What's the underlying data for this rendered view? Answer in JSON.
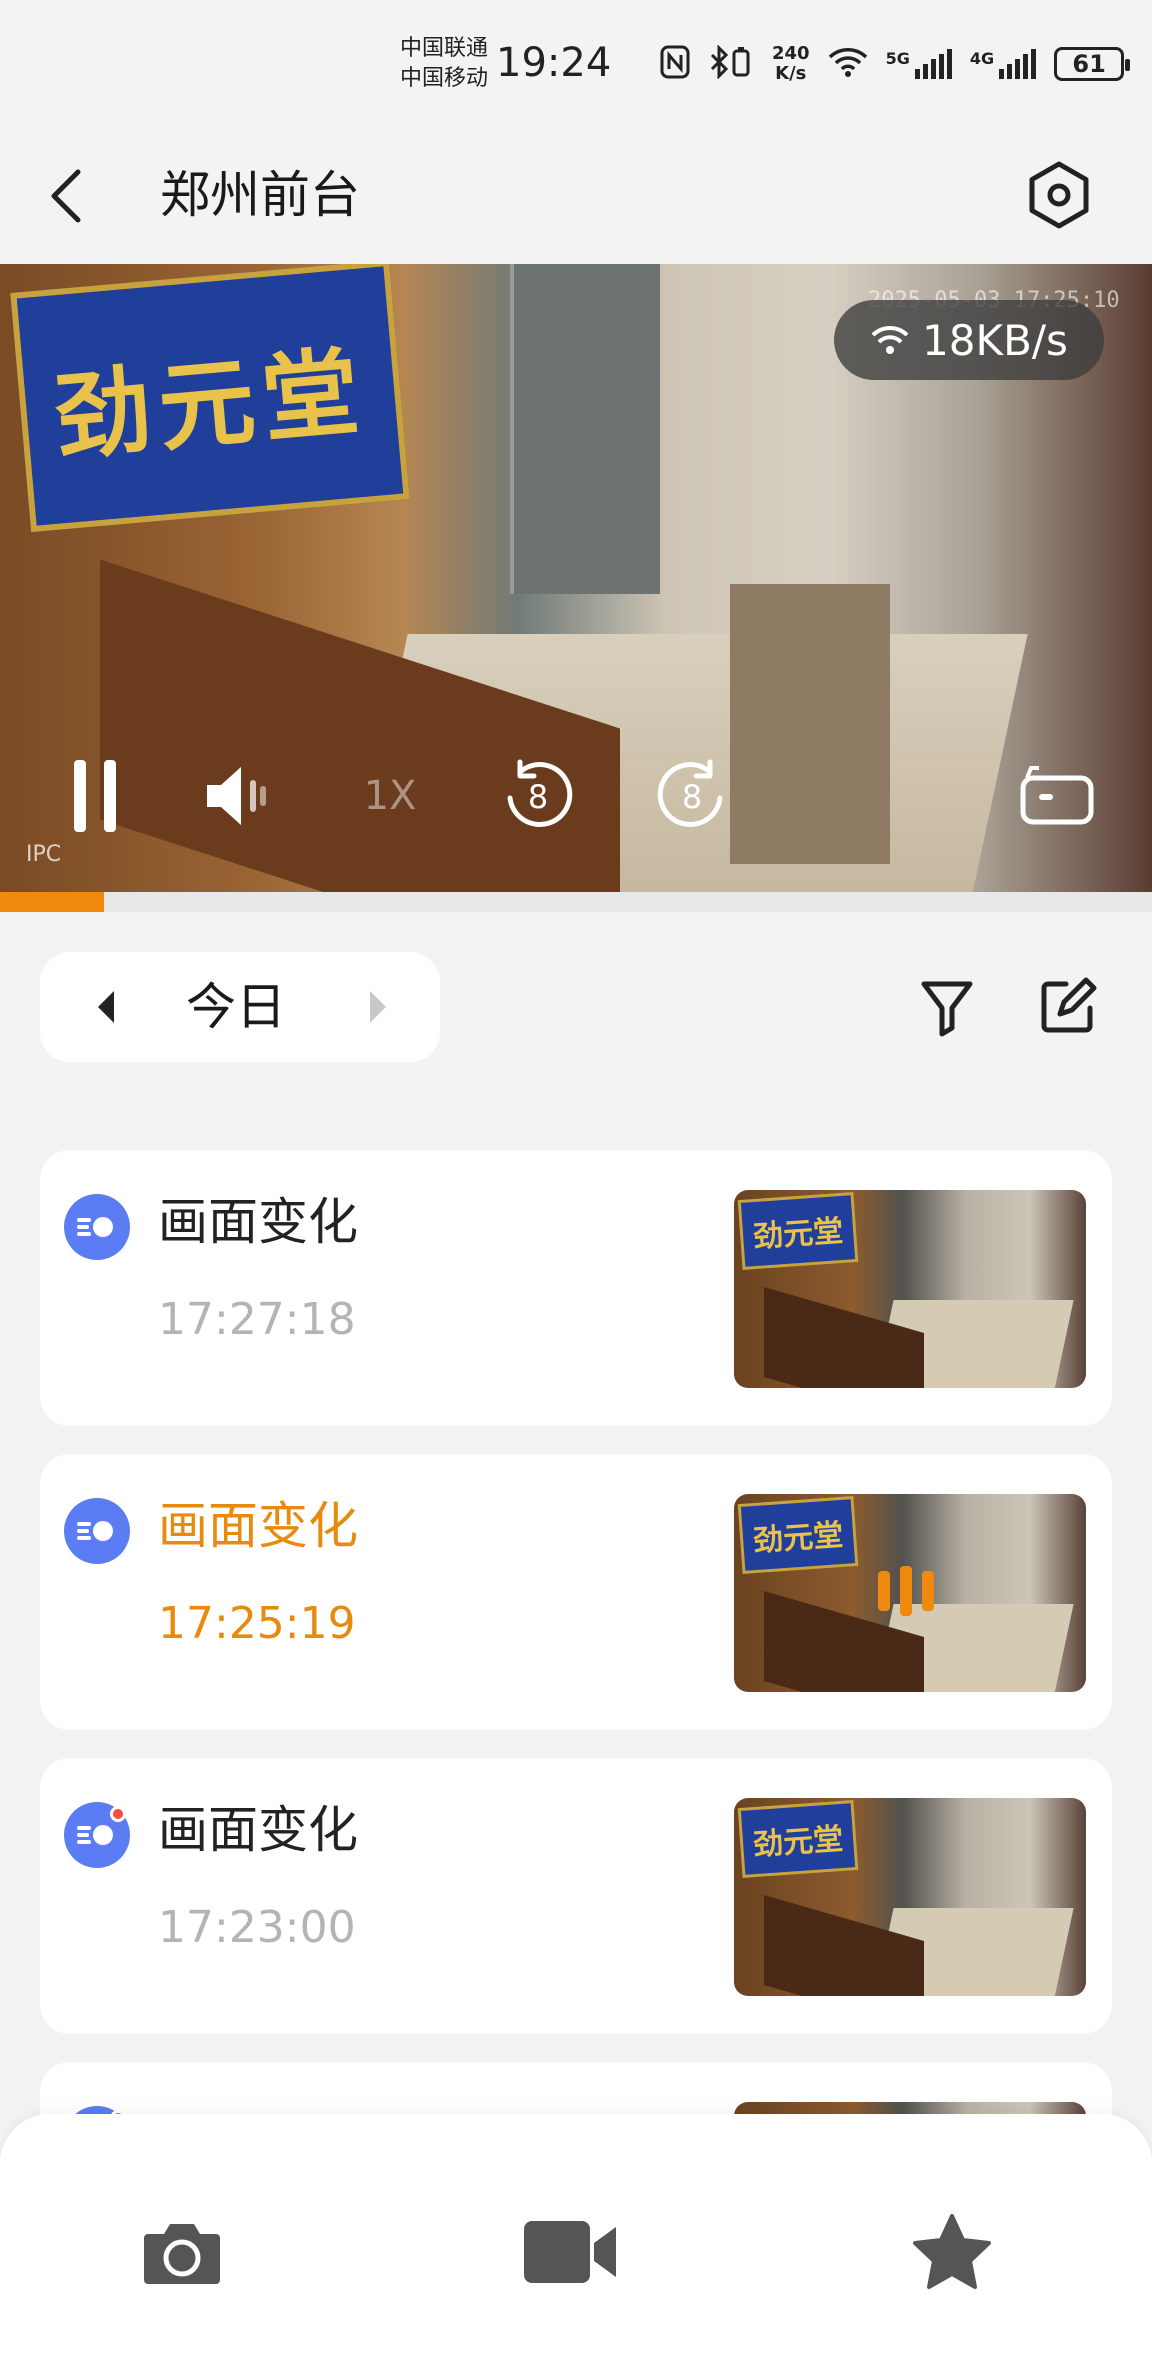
{
  "status_bar": {
    "carrier_1": "中国联通",
    "carrier_2": "中国移动",
    "time": "19:24",
    "net_speed_value": "240",
    "net_speed_unit": "K/s",
    "mobile_1_label": "5G",
    "mobile_2_label": "4G",
    "battery": "61"
  },
  "header": {
    "title": "郑州前台"
  },
  "video": {
    "timestamp": "2025-05-03 17:25:10",
    "bitrate": "18KB/s",
    "source_label": "IPC",
    "speed_label": "1X",
    "rewind_seconds": "8",
    "forward_seconds": "8",
    "progress": 0.09,
    "accent_color": "#f08a0e"
  },
  "date_selector": {
    "label": "今日"
  },
  "events": [
    {
      "title": "画面变化",
      "time": "17:27:18",
      "active": false,
      "unread": false
    },
    {
      "title": "画面变化",
      "time": "17:25:19",
      "active": true,
      "unread": false
    },
    {
      "title": "画面变化",
      "time": "17:23:00",
      "active": false,
      "unread": true
    }
  ],
  "bottom_bar": {
    "snapshot_icon": "camera-icon",
    "record_icon": "video-camera-icon",
    "favorite_icon": "star-icon"
  },
  "colors": {
    "accent": "#f08a0e",
    "event_icon": "#5b7cf2",
    "unread_dot": "#ff4a3c"
  }
}
